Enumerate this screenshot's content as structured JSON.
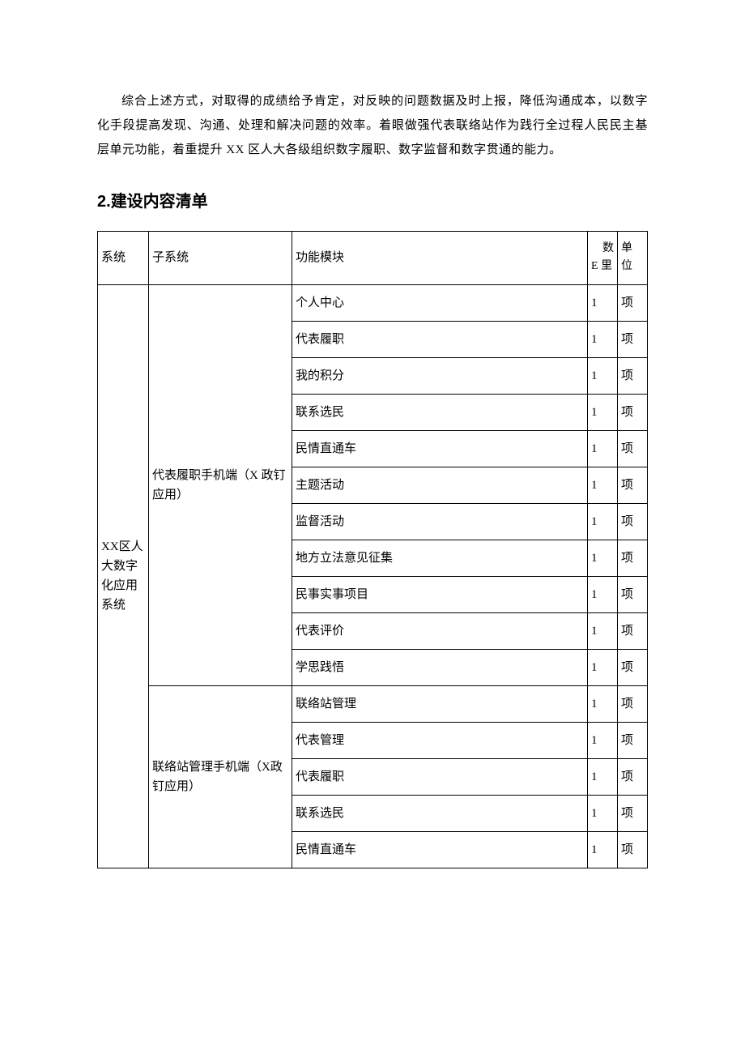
{
  "paragraph": "综合上述方式，对取得的成绩给予肯定，对反映的问题数据及时上报，降低沟通成本，以数字化手段提高发现、沟通、处理和解决问题的效率。着眼做强代表联络站作为践行全过程人民民主基层单元功能，着重提升 XX 区人大各级组织数字履职、数字监督和数字贯通的能力。",
  "heading_num": "2.",
  "heading_text": "建设内容清单",
  "table": {
    "headers": {
      "system": "系统",
      "subsystem": "子系统",
      "module": "功能模块",
      "qty_line1": "数",
      "qty_line2": "E 里",
      "unit_line1": "单",
      "unit_line2": "位"
    },
    "system_label": "XX区人大数字化应用系统",
    "groups": [
      {
        "subsystem": "代表履职手机端（X 政钉应用）",
        "rows": [
          {
            "module": "个人中心",
            "qty": "1",
            "unit": "项"
          },
          {
            "module": "代表履职",
            "qty": "1",
            "unit": "项"
          },
          {
            "module": "我的积分",
            "qty": "1",
            "unit": "项"
          },
          {
            "module": "联系选民",
            "qty": "1",
            "unit": "项"
          },
          {
            "module": "民情直通车",
            "qty": "1",
            "unit": "项"
          },
          {
            "module": "主题活动",
            "qty": "1",
            "unit": "项"
          },
          {
            "module": "监督活动",
            "qty": "1",
            "unit": "项"
          },
          {
            "module": "地方立法意见征集",
            "qty": "1",
            "unit": "项"
          },
          {
            "module": "民事实事项目",
            "qty": "1",
            "unit": "项"
          },
          {
            "module": "代表评价",
            "qty": "1",
            "unit": "项"
          },
          {
            "module": "学思践悟",
            "qty": "1",
            "unit": "项"
          }
        ]
      },
      {
        "subsystem": "联络站管理手机端（X政钉应用）",
        "rows": [
          {
            "module": "联络站管理",
            "qty": "1",
            "unit": "项"
          },
          {
            "module": "代表管理",
            "qty": "1",
            "unit": "项"
          },
          {
            "module": "代表履职",
            "qty": "1",
            "unit": "项"
          },
          {
            "module": "联系选民",
            "qty": "1",
            "unit": "项"
          },
          {
            "module": "民情直通车",
            "qty": "1",
            "unit": "项"
          }
        ]
      }
    ]
  }
}
